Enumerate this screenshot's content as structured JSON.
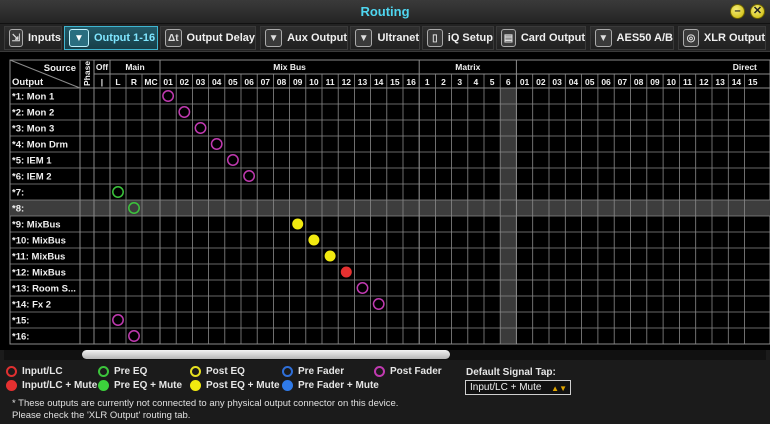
{
  "window": {
    "title": "Routing"
  },
  "tabs": [
    {
      "label": "Inputs",
      "icon": "input-jack-icon"
    },
    {
      "label": "Output 1-16",
      "icon": "output-jack-icon",
      "active": true
    },
    {
      "label": "Output Delay",
      "icon": "delta-t-icon"
    },
    {
      "label": "Aux Output",
      "icon": "aux-jack-icon"
    },
    {
      "label": "Ultranet",
      "icon": "ultranet-icon"
    },
    {
      "label": "iQ Setup",
      "icon": "speaker-icon"
    },
    {
      "label": "Card Output",
      "icon": "card-icon"
    },
    {
      "label": "AES50 A/B",
      "icon": "aes50-icon"
    },
    {
      "label": "XLR Output",
      "icon": "xlr-icon"
    }
  ],
  "grid": {
    "corner": {
      "top": "Source",
      "bottom": "Output"
    },
    "groups": [
      {
        "label": "Phase"
      },
      {
        "label": "Off"
      },
      {
        "label": "Main"
      },
      {
        "label": "Mix Bus"
      },
      {
        "label": "Matrix"
      },
      {
        "label": "Direct"
      }
    ],
    "sub_columns": {
      "off": [
        "|"
      ],
      "main": [
        "L",
        "R",
        "MC"
      ],
      "mixbus": [
        "01",
        "02",
        "03",
        "04",
        "05",
        "06",
        "07",
        "08",
        "09",
        "10",
        "11",
        "12",
        "13",
        "14",
        "15",
        "16"
      ],
      "matrix": [
        "1",
        "2",
        "3",
        "4",
        "5",
        "6"
      ],
      "direct": [
        "01",
        "02",
        "03",
        "04",
        "05",
        "06",
        "07",
        "08",
        "09",
        "10",
        "11",
        "12",
        "13",
        "14",
        "15"
      ]
    },
    "rows": [
      "*1: Mon 1",
      "*2: Mon 2",
      "*3: Mon 3",
      "*4: Mon Drm",
      "*5: IEM 1",
      "*6: IEM 2",
      "*7:",
      "*8:",
      "*9: MixBus",
      "*10: MixBus",
      "*11: MixBus",
      "*12: MixBus",
      "*13: Room S...",
      "*14: Fx 2",
      "*15:",
      "*16:"
    ],
    "assignments": [
      {
        "row": 0,
        "col": "mixbus:01",
        "tap": "post_fader"
      },
      {
        "row": 1,
        "col": "mixbus:02",
        "tap": "post_fader"
      },
      {
        "row": 2,
        "col": "mixbus:03",
        "tap": "post_fader"
      },
      {
        "row": 3,
        "col": "mixbus:04",
        "tap": "post_fader"
      },
      {
        "row": 4,
        "col": "mixbus:05",
        "tap": "post_fader"
      },
      {
        "row": 5,
        "col": "mixbus:06",
        "tap": "post_fader"
      },
      {
        "row": 6,
        "col": "main:L",
        "tap": "pre_eq"
      },
      {
        "row": 7,
        "col": "main:R",
        "tap": "pre_eq"
      },
      {
        "row": 8,
        "col": "mixbus:09",
        "tap": "post_eq_mute"
      },
      {
        "row": 9,
        "col": "mixbus:10",
        "tap": "post_eq_mute"
      },
      {
        "row": 10,
        "col": "mixbus:11",
        "tap": "post_eq_mute"
      },
      {
        "row": 11,
        "col": "mixbus:12",
        "tap": "input_lc_mute"
      },
      {
        "row": 12,
        "col": "mixbus:13",
        "tap": "post_fader"
      },
      {
        "row": 13,
        "col": "mixbus:14",
        "tap": "post_fader"
      },
      {
        "row": 14,
        "col": "main:L",
        "tap": "post_fader"
      },
      {
        "row": 15,
        "col": "main:R",
        "tap": "post_fader"
      }
    ],
    "selected_row": 7
  },
  "legend": [
    {
      "key": "input_lc",
      "label": "Input/LC",
      "color": "#e03030",
      "filled": false
    },
    {
      "key": "input_lc_mute",
      "label": "Input/LC + Mute",
      "color": "#e53030",
      "filled": true
    },
    {
      "key": "pre_eq",
      "label": "Pre EQ",
      "color": "#3cc43c",
      "filled": false
    },
    {
      "key": "pre_eq_mute",
      "label": "Pre EQ + Mute",
      "color": "#3cd23c",
      "filled": true
    },
    {
      "key": "post_eq",
      "label": "Post EQ",
      "color": "#e6e020",
      "filled": false
    },
    {
      "key": "post_eq_mute",
      "label": "Post EQ + Mute",
      "color": "#f2ea10",
      "filled": true
    },
    {
      "key": "pre_fader",
      "label": "Pre Fader",
      "color": "#2f6fd8",
      "filled": false
    },
    {
      "key": "pre_fader_mute",
      "label": "Pre Fader + Mute",
      "color": "#2f7ae8",
      "filled": true
    },
    {
      "key": "post_fader",
      "label": "Post Fader",
      "color": "#c03ab0",
      "filled": false
    }
  ],
  "default_tap": {
    "label": "Default Signal Tap:",
    "value": "Input/LC + Mute"
  },
  "footnote": "* These outputs are currently not connected to any physical output connector on this device. Please check the 'XLR Output' routing tab."
}
